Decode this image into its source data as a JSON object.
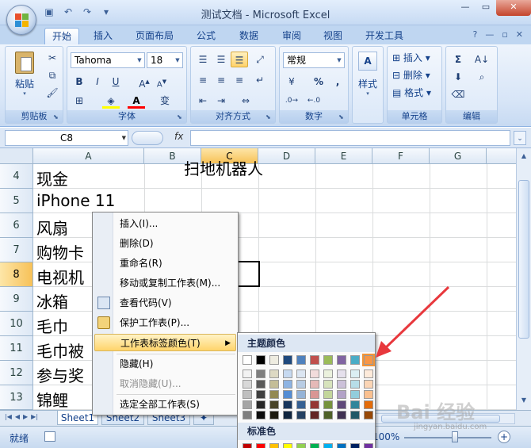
{
  "window": {
    "title": "测试文档 - Microsoft Excel"
  },
  "ribbon_tabs": [
    "开始",
    "插入",
    "页面布局",
    "公式",
    "数据",
    "审阅",
    "视图",
    "开发工具"
  ],
  "ribbon": {
    "paste_label": "粘贴",
    "font_name": "Tahoma",
    "font_size": "18",
    "number_format": "常规",
    "percent": "%",
    "comma": ",",
    "style_label": "样式",
    "insert_label": "插入",
    "delete_label": "删除",
    "format_label": "格式",
    "wen_char": "变",
    "groups": {
      "clipboard": "剪贴板",
      "font": "字体",
      "alignment": "对齐方式",
      "number": "数字",
      "cells": "单元格",
      "editing": "编辑"
    }
  },
  "formula_bar": {
    "name_box": "C8",
    "fx": "fx",
    "value": ""
  },
  "columns": [
    "A",
    "B",
    "C",
    "D",
    "E",
    "F",
    "G"
  ],
  "rows": [
    {
      "num": "4",
      "a": "现金"
    },
    {
      "num": "5",
      "a": "iPhone 11"
    },
    {
      "num": "6",
      "a": "风扇"
    },
    {
      "num": "7",
      "a": "购物卡"
    },
    {
      "num": "8",
      "a": "电视机"
    },
    {
      "num": "9",
      "a": "冰箱"
    },
    {
      "num": "10",
      "a": "毛巾"
    },
    {
      "num": "11",
      "a": "毛巾被"
    },
    {
      "num": "12",
      "a": "参与奖"
    },
    {
      "num": "13",
      "a": "锦鲤"
    }
  ],
  "top_clip_text": "扫地机器人",
  "sheet_tabs": [
    "Sheet1",
    "Sheet2",
    "Sheet3"
  ],
  "status": {
    "ready": "就绪",
    "zoom": "100%",
    "plus": "+"
  },
  "context_menu": [
    {
      "label": "插入(I)...",
      "disabled": false
    },
    {
      "label": "删除(D)",
      "disabled": false
    },
    {
      "label": "重命名(R)",
      "disabled": false
    },
    {
      "label": "移动或复制工作表(M)...",
      "disabled": false
    },
    {
      "label": "查看代码(V)",
      "disabled": false
    },
    {
      "label": "保护工作表(P)...",
      "disabled": false
    },
    {
      "label": "工作表标签颜色(T)",
      "disabled": false
    },
    {
      "label": "隐藏(H)",
      "disabled": false
    },
    {
      "label": "取消隐藏(U)...",
      "disabled": true
    },
    {
      "label": "选定全部工作表(S)",
      "disabled": false
    }
  ],
  "palette": {
    "theme_title": "主题颜色",
    "standard_title": "标准色",
    "theme_top": [
      "#ffffff",
      "#000000",
      "#eeece1",
      "#1f497d",
      "#4f81bd",
      "#c0504d",
      "#9bbb59",
      "#8064a2",
      "#4bacc6",
      "#f79646"
    ],
    "theme_shades": [
      [
        "#f2f2f2",
        "#d8d8d8",
        "#bfbfbf",
        "#a5a5a5",
        "#7f7f7f"
      ],
      [
        "#7f7f7f",
        "#595959",
        "#3f3f3f",
        "#262626",
        "#0c0c0c"
      ],
      [
        "#ddd9c3",
        "#c4bd97",
        "#938953",
        "#494429",
        "#1d1b10"
      ],
      [
        "#c6d9f0",
        "#8db3e2",
        "#548dd4",
        "#17365d",
        "#0f243e"
      ],
      [
        "#dbe5f1",
        "#b8cce4",
        "#95b3d7",
        "#366092",
        "#244061"
      ],
      [
        "#f2dcdb",
        "#e5b9b7",
        "#d99694",
        "#953734",
        "#632423"
      ],
      [
        "#ebf1dd",
        "#d7e3bc",
        "#c3d69b",
        "#76923c",
        "#4f6128"
      ],
      [
        "#e5e0ec",
        "#ccc1d9",
        "#b2a2c7",
        "#5f497a",
        "#3f3151"
      ],
      [
        "#dbeef3",
        "#b7dde8",
        "#92cddc",
        "#31859b",
        "#205867"
      ],
      [
        "#fdeada",
        "#fbd5b5",
        "#fac08f",
        "#e36c09",
        "#974806"
      ]
    ],
    "standard": [
      "#c00000",
      "#ff0000",
      "#ffc000",
      "#ffff00",
      "#92d050",
      "#00b050",
      "#00b0f0",
      "#0070c0",
      "#002060",
      "#7030a0"
    ],
    "selected_index": 9
  },
  "watermark": {
    "text": "Bai 经验",
    "sub": "jingyan.baidu.com"
  },
  "accent_colors": {
    "arrow": "#e8383d",
    "ribbon": "#15428b"
  }
}
